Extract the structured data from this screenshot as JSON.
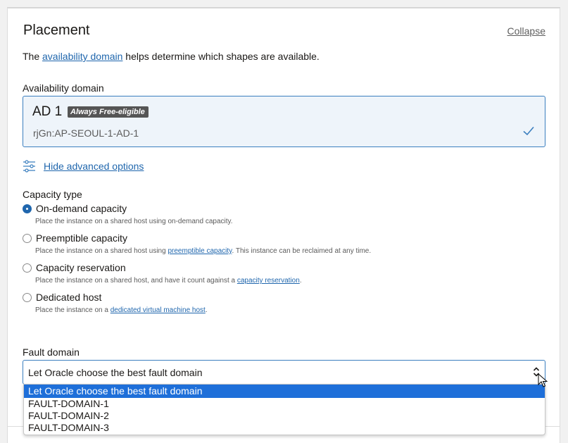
{
  "placement": {
    "title": "Placement",
    "collapse_label": "Collapse",
    "intro_prefix": "The ",
    "intro_link": "availability domain",
    "intro_suffix": " helps determine which shapes are available."
  },
  "availability_domain": {
    "label": "Availability domain",
    "name": "AD 1",
    "badge": "Always Free-eligible",
    "sub": "rjGn:AP-SEOUL-1-AD-1"
  },
  "advanced": {
    "label": "Hide advanced options"
  },
  "capacity": {
    "label": "Capacity type",
    "options": [
      {
        "label": "On-demand capacity",
        "checked": true,
        "desc_prefix": "Place the instance on a shared host using on-demand capacity.",
        "desc_link": "",
        "desc_suffix": ""
      },
      {
        "label": "Preemptible capacity",
        "checked": false,
        "desc_prefix": "Place the instance on a shared host using ",
        "desc_link": "preemptible capacity",
        "desc_suffix": ". This instance can be reclaimed at any time."
      },
      {
        "label": "Capacity reservation",
        "checked": false,
        "desc_prefix": "Place the instance on a shared host, and have it count against a ",
        "desc_link": "capacity reservation",
        "desc_suffix": "."
      },
      {
        "label": "Dedicated host",
        "checked": false,
        "desc_prefix": "Place the instance on a ",
        "desc_link": "dedicated virtual machine host",
        "desc_suffix": "."
      }
    ]
  },
  "fault_domain": {
    "label": "Fault domain",
    "selected": "Let Oracle choose the best fault domain",
    "options": [
      "Let Oracle choose the best fault domain",
      "FAULT-DOMAIN-1",
      "FAULT-DOMAIN-2",
      "FAULT-DOMAIN-3"
    ]
  },
  "colors": {
    "accent": "#1f66ad",
    "highlight": "#1e6fd9",
    "badge_bg": "#555555"
  },
  "icons": {
    "check": "check-icon",
    "sliders": "sliders-icon",
    "select_arrows": "chevron-up-down-icon",
    "cursor": "mouse-cursor-icon"
  }
}
